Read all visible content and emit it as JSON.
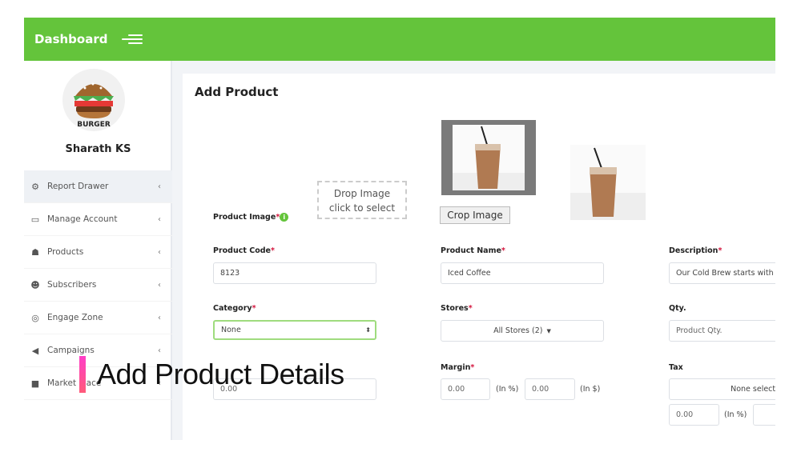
{
  "header": {
    "title": "Dashboard",
    "menu_icon": "hamburger-menu-icon"
  },
  "sidebar": {
    "logo_text": "BURGER",
    "user_name": "Sharath KS",
    "items": [
      {
        "label": "Report Drawer",
        "icon": "dashboard-icon",
        "active": true
      },
      {
        "label": "Manage Account",
        "icon": "laptop-icon"
      },
      {
        "label": "Products",
        "icon": "cubes-icon"
      },
      {
        "label": "Subscribers",
        "icon": "users-icon"
      },
      {
        "label": "Engage Zone",
        "icon": "target-icon"
      },
      {
        "label": "Campaigns",
        "icon": "megaphone-icon"
      },
      {
        "label": "Market Place",
        "icon": "shopping-bag-icon"
      }
    ]
  },
  "form": {
    "title": "Add Product",
    "product_image_label": "Product Image",
    "drop_line1": "Drop Image",
    "drop_line2": "click to select",
    "crop_button": "Crop Image",
    "product_code_label": "Product Code",
    "product_code_value": "8123",
    "product_name_label": "Product Name",
    "product_name_value": "Iced Coffee",
    "description_label": "Description",
    "description_value": "Our Cold Brew starts with",
    "category_label": "Category",
    "category_value": "None",
    "stores_label": "Stores",
    "stores_value": "All Stores (2)",
    "qty_label": "Qty.",
    "qty_placeholder": "Product Qty.",
    "item_cost_value": "0.00",
    "margin_label": "Margin",
    "margin_pct": "0.00",
    "margin_pct_unit": "(In %)",
    "margin_amt": "0.00",
    "margin_amt_unit": "(In $)",
    "tax_label": "Tax",
    "tax_value": "None selected",
    "tax_pct": "0.00",
    "tax_pct_unit": "(In %)",
    "required_mark": "*"
  },
  "overlay": {
    "caption": "Add Product Details",
    "accent": "#ff3ec8"
  },
  "colors": {
    "brand": "#64c43b",
    "required": "#d3143c"
  }
}
